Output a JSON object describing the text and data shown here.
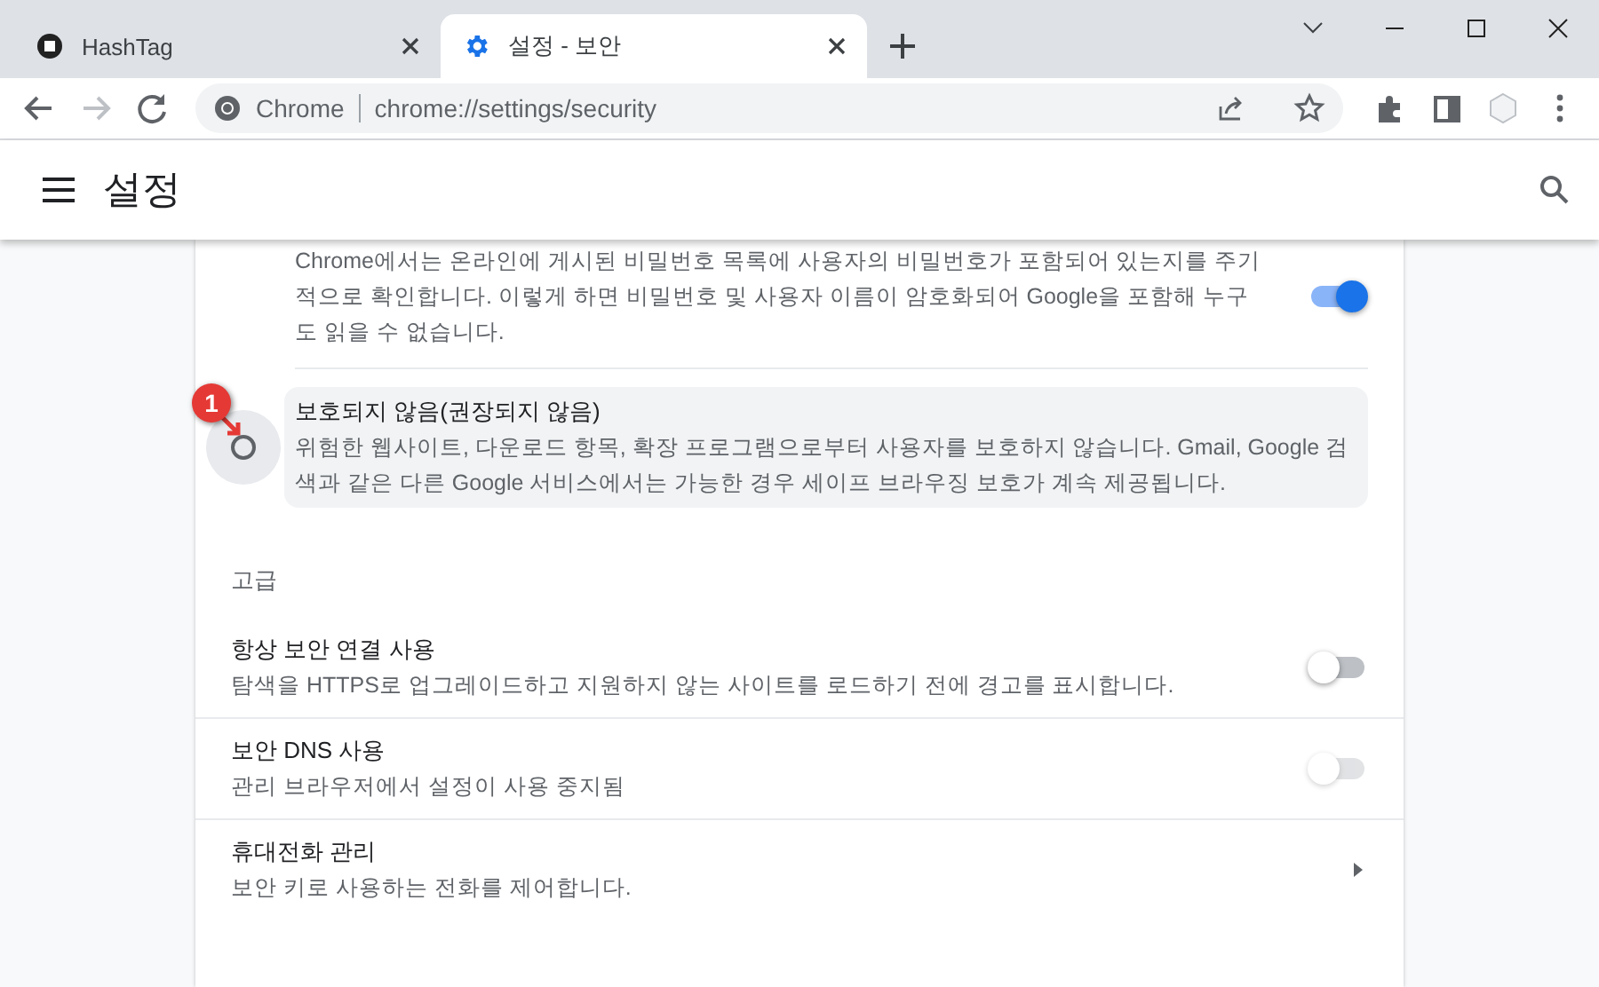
{
  "tabs": [
    {
      "title": "HashTag",
      "selected": false
    },
    {
      "title": "설정 - 보안",
      "selected": true
    }
  ],
  "address_bar": {
    "site_label": "Chrome",
    "url": "chrome://settings/security"
  },
  "header": {
    "title": "설정"
  },
  "password_check": {
    "description": "Chrome에서는 온라인에 게시된 비밀번호 목록에 사용자의 비밀번호가 포함되어 있는지를 주기적으로 확인합니다. 이렇게 하면 비밀번호 및 사용자 이름이 암호화되어 Google을 포함해 누구도 읽을 수 없습니다.",
    "on": true
  },
  "protection_option": {
    "label": "보호되지 않음(권장되지 않음)",
    "description": "위험한 웹사이트, 다운로드 항목, 확장 프로그램으로부터 사용자를 보호하지 않습니다. Gmail, Google 검색과 같은 다른 Google 서비스에서는 가능한 경우 세이프 브라우징 보호가 계속 제공됩니다.",
    "selected": false,
    "callout": "1"
  },
  "advanced": {
    "heading": "고급",
    "rows": [
      {
        "kind": "toggle",
        "title": "항상 보안 연결 사용",
        "description": "탐색을 HTTPS로 업그레이드하고 지원하지 않는 사이트를 로드하기 전에 경고를 표시합니다.",
        "on": false,
        "disabled": false
      },
      {
        "kind": "toggle",
        "title": "보안 DNS 사용",
        "description": "관리 브라우저에서 설정이 사용 중지됨",
        "on": false,
        "disabled": true
      },
      {
        "kind": "link",
        "title": "휴대전화 관리",
        "description": "보안 키로 사용하는 전화를 제어합니다."
      }
    ]
  }
}
